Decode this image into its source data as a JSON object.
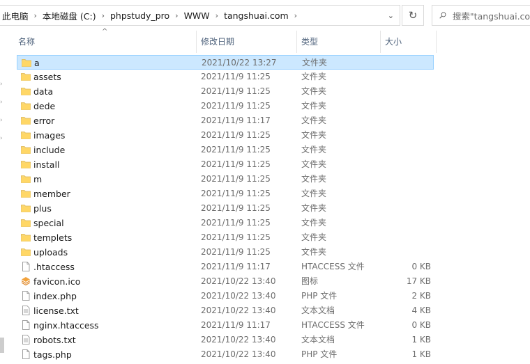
{
  "breadcrumb": [
    "此电脑",
    "本地磁盘 (C:)",
    "phpstudy_pro",
    "WWW",
    "tangshuai.com"
  ],
  "search": {
    "placeholder": "搜索\"tangshuai.com\""
  },
  "columns": {
    "name": "名称",
    "date": "修改日期",
    "type": "类型",
    "size": "大小"
  },
  "colors": {
    "selection": "#cce8ff",
    "selection_border": "#99d1ff",
    "folder": "#ffd766"
  },
  "files": [
    {
      "name": "a",
      "date": "2021/10/22 13:27",
      "type": "文件夹",
      "size": "",
      "icon": "folder-icon",
      "selected": true
    },
    {
      "name": "assets",
      "date": "2021/11/9 11:25",
      "type": "文件夹",
      "size": "",
      "icon": "folder-icon"
    },
    {
      "name": "data",
      "date": "2021/11/9 11:25",
      "type": "文件夹",
      "size": "",
      "icon": "folder-icon"
    },
    {
      "name": "dede",
      "date": "2021/11/9 11:25",
      "type": "文件夹",
      "size": "",
      "icon": "folder-icon"
    },
    {
      "name": "error",
      "date": "2021/11/9 11:17",
      "type": "文件夹",
      "size": "",
      "icon": "folder-icon"
    },
    {
      "name": "images",
      "date": "2021/11/9 11:25",
      "type": "文件夹",
      "size": "",
      "icon": "folder-icon"
    },
    {
      "name": "include",
      "date": "2021/11/9 11:25",
      "type": "文件夹",
      "size": "",
      "icon": "folder-icon"
    },
    {
      "name": "install",
      "date": "2021/11/9 11:25",
      "type": "文件夹",
      "size": "",
      "icon": "folder-icon"
    },
    {
      "name": "m",
      "date": "2021/11/9 11:25",
      "type": "文件夹",
      "size": "",
      "icon": "folder-icon"
    },
    {
      "name": "member",
      "date": "2021/11/9 11:25",
      "type": "文件夹",
      "size": "",
      "icon": "folder-icon"
    },
    {
      "name": "plus",
      "date": "2021/11/9 11:25",
      "type": "文件夹",
      "size": "",
      "icon": "folder-icon"
    },
    {
      "name": "special",
      "date": "2021/11/9 11:25",
      "type": "文件夹",
      "size": "",
      "icon": "folder-icon"
    },
    {
      "name": "templets",
      "date": "2021/11/9 11:25",
      "type": "文件夹",
      "size": "",
      "icon": "folder-icon"
    },
    {
      "name": "uploads",
      "date": "2021/11/9 11:25",
      "type": "文件夹",
      "size": "",
      "icon": "folder-icon"
    },
    {
      "name": ".htaccess",
      "date": "2021/11/9 11:17",
      "type": "HTACCESS 文件",
      "size": "0 KB",
      "icon": "file-icon"
    },
    {
      "name": "favicon.ico",
      "date": "2021/10/22 13:40",
      "type": "图标",
      "size": "17 KB",
      "icon": "favicon-icon"
    },
    {
      "name": "index.php",
      "date": "2021/10/22 13:40",
      "type": "PHP 文件",
      "size": "2 KB",
      "icon": "file-icon"
    },
    {
      "name": "license.txt",
      "date": "2021/10/22 13:40",
      "type": "文本文档",
      "size": "4 KB",
      "icon": "text-file-icon"
    },
    {
      "name": "nginx.htaccess",
      "date": "2021/11/9 11:17",
      "type": "HTACCESS 文件",
      "size": "0 KB",
      "icon": "file-icon"
    },
    {
      "name": "robots.txt",
      "date": "2021/10/22 13:40",
      "type": "文本文档",
      "size": "1 KB",
      "icon": "text-file-icon"
    },
    {
      "name": "tags.php",
      "date": "2021/10/22 13:40",
      "type": "PHP 文件",
      "size": "1 KB",
      "icon": "file-icon"
    }
  ]
}
